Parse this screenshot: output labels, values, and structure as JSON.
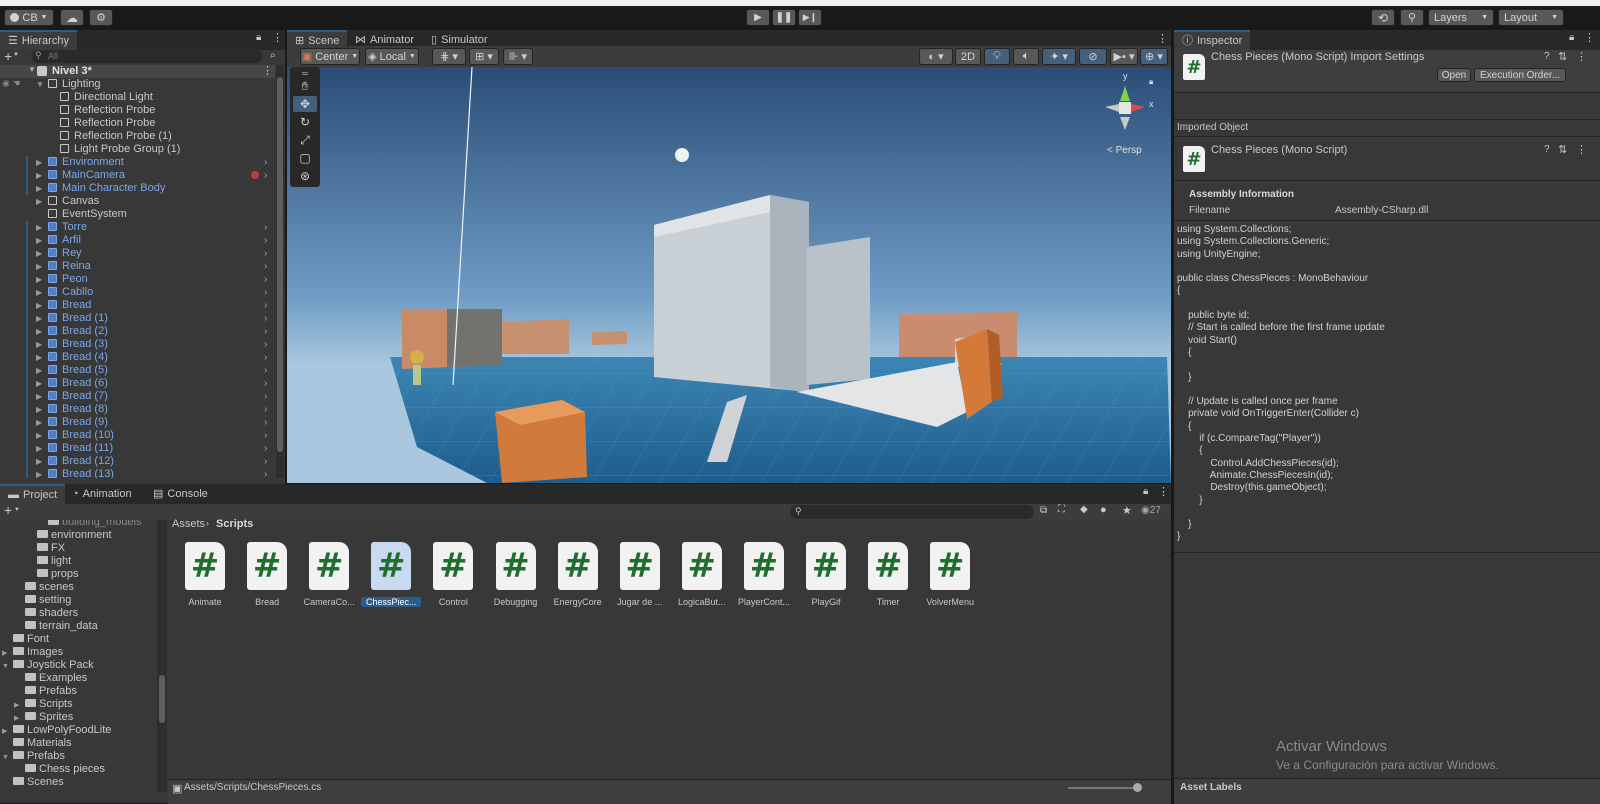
{
  "toolbar": {
    "account": "CB",
    "layers": "Layers",
    "layout": "Layout"
  },
  "hierarchy": {
    "tab": "Hierarchy",
    "search_placeholder": "All",
    "scene": "Nivel 3*",
    "items": [
      {
        "label": "Lighting",
        "indent": 1,
        "blue": false,
        "expand": "open",
        "arrow": false
      },
      {
        "label": "Directional Light",
        "indent": 2,
        "blue": false,
        "expand": "",
        "arrow": false
      },
      {
        "label": "Reflection Probe",
        "indent": 2,
        "blue": false,
        "expand": "",
        "arrow": false
      },
      {
        "label": "Reflection Probe",
        "indent": 2,
        "blue": false,
        "expand": "",
        "arrow": false
      },
      {
        "label": "Reflection Probe (1)",
        "indent": 2,
        "blue": false,
        "expand": "",
        "arrow": false
      },
      {
        "label": "Light Probe Group (1)",
        "indent": 2,
        "blue": false,
        "expand": "",
        "arrow": false
      },
      {
        "label": "Environment",
        "indent": 1,
        "blue": true,
        "expand": "closed",
        "arrow": true
      },
      {
        "label": "MainCamera",
        "indent": 1,
        "blue": true,
        "expand": "closed",
        "arrow": true
      },
      {
        "label": "Main Character Body",
        "indent": 1,
        "blue": true,
        "expand": "closed",
        "arrow": false
      },
      {
        "label": "Canvas",
        "indent": 1,
        "blue": false,
        "expand": "closed",
        "arrow": false
      },
      {
        "label": "EventSystem",
        "indent": 1,
        "blue": false,
        "expand": "",
        "arrow": false
      },
      {
        "label": "Torre",
        "indent": 1,
        "blue": true,
        "expand": "closed",
        "arrow": true
      },
      {
        "label": "Arfil",
        "indent": 1,
        "blue": true,
        "expand": "closed",
        "arrow": true
      },
      {
        "label": "Rey",
        "indent": 1,
        "blue": true,
        "expand": "closed",
        "arrow": true
      },
      {
        "label": "Reina",
        "indent": 1,
        "blue": true,
        "expand": "closed",
        "arrow": true
      },
      {
        "label": "Peon",
        "indent": 1,
        "blue": true,
        "expand": "closed",
        "arrow": true
      },
      {
        "label": "Cabllo",
        "indent": 1,
        "blue": true,
        "expand": "closed",
        "arrow": true
      },
      {
        "label": "Bread",
        "indent": 1,
        "blue": true,
        "expand": "closed",
        "arrow": true
      },
      {
        "label": "Bread (1)",
        "indent": 1,
        "blue": true,
        "expand": "closed",
        "arrow": true
      },
      {
        "label": "Bread (2)",
        "indent": 1,
        "blue": true,
        "expand": "closed",
        "arrow": true
      },
      {
        "label": "Bread (3)",
        "indent": 1,
        "blue": true,
        "expand": "closed",
        "arrow": true
      },
      {
        "label": "Bread (4)",
        "indent": 1,
        "blue": true,
        "expand": "closed",
        "arrow": true
      },
      {
        "label": "Bread (5)",
        "indent": 1,
        "blue": true,
        "expand": "closed",
        "arrow": true
      },
      {
        "label": "Bread (6)",
        "indent": 1,
        "blue": true,
        "expand": "closed",
        "arrow": true
      },
      {
        "label": "Bread (7)",
        "indent": 1,
        "blue": true,
        "expand": "closed",
        "arrow": true
      },
      {
        "label": "Bread (8)",
        "indent": 1,
        "blue": true,
        "expand": "closed",
        "arrow": true
      },
      {
        "label": "Bread (9)",
        "indent": 1,
        "blue": true,
        "expand": "closed",
        "arrow": true
      },
      {
        "label": "Bread (10)",
        "indent": 1,
        "blue": true,
        "expand": "closed",
        "arrow": true
      },
      {
        "label": "Bread (11)",
        "indent": 1,
        "blue": true,
        "expand": "closed",
        "arrow": true
      },
      {
        "label": "Bread (12)",
        "indent": 1,
        "blue": true,
        "expand": "closed",
        "arrow": true
      },
      {
        "label": "Bread (13)",
        "indent": 1,
        "blue": true,
        "expand": "closed",
        "arrow": true
      }
    ]
  },
  "scene": {
    "tabs": [
      "Scene",
      "Animator",
      "Simulator"
    ],
    "pivot": "Center",
    "space": "Local",
    "mode2d": "2D",
    "persp": "< Persp",
    "gizmo_y": "y",
    "gizmo_x": "x"
  },
  "inspector": {
    "tab": "Inspector",
    "title": "Chess Pieces (Mono Script) Import Settings",
    "open_label": "Open",
    "execution_label": "Execution Order...",
    "imported_object": "Imported Object",
    "object_name": "Chess Pieces (Mono Script)",
    "assembly_header": "Assembly Information",
    "filename_label": "Filename",
    "filename_value": "Assembly-CSharp.dll",
    "code": "using System.Collections;\nusing System.Collections.Generic;\nusing UnityEngine;\n\npublic class ChessPieces : MonoBehaviour\n{\n\n    public byte id;\n    // Start is called before the first frame update\n    void Start()\n    {\n\n    }\n\n    // Update is called once per frame\n    private void OnTriggerEnter(Collider c)\n    {\n        if (c.CompareTag(\"Player\"))\n        {\n            Control.AddChessPieces(id);\n            Animate.ChessPiecesIn(id);\n            Destroy(this.gameObject);\n        }\n\n    }\n}",
    "asset_labels": "Asset Labels"
  },
  "project": {
    "tabs": [
      "Project",
      "Animation",
      "Console"
    ],
    "breadcrumb_root": "Assets",
    "breadcrumb_leaf": "Scripts",
    "hidden_count": "27",
    "tree": [
      {
        "label": "environment",
        "indent": 3,
        "arrow": ""
      },
      {
        "label": "FX",
        "indent": 3,
        "arrow": ""
      },
      {
        "label": "light",
        "indent": 3,
        "arrow": ""
      },
      {
        "label": "props",
        "indent": 3,
        "arrow": ""
      },
      {
        "label": "scenes",
        "indent": 2,
        "arrow": ""
      },
      {
        "label": "setting",
        "indent": 2,
        "arrow": ""
      },
      {
        "label": "shaders",
        "indent": 2,
        "arrow": ""
      },
      {
        "label": "terrain_data",
        "indent": 2,
        "arrow": ""
      },
      {
        "label": "Font",
        "indent": 1,
        "arrow": ""
      },
      {
        "label": "Images",
        "indent": 1,
        "arrow": "closed"
      },
      {
        "label": "Joystick Pack",
        "indent": 1,
        "arrow": "open"
      },
      {
        "label": "Examples",
        "indent": 2,
        "arrow": ""
      },
      {
        "label": "Prefabs",
        "indent": 2,
        "arrow": ""
      },
      {
        "label": "Scripts",
        "indent": 2,
        "arrow": "closed"
      },
      {
        "label": "Sprites",
        "indent": 2,
        "arrow": "closed"
      },
      {
        "label": "LowPolyFoodLite",
        "indent": 1,
        "arrow": "closed"
      },
      {
        "label": "Materials",
        "indent": 1,
        "arrow": ""
      },
      {
        "label": "Prefabs",
        "indent": 1,
        "arrow": "open"
      },
      {
        "label": "Chess pieces",
        "indent": 2,
        "arrow": ""
      },
      {
        "label": "Scenes",
        "indent": 1,
        "arrow": ""
      }
    ],
    "assets": [
      {
        "label": "Animate",
        "selected": false
      },
      {
        "label": "Bread",
        "selected": false
      },
      {
        "label": "CameraCo...",
        "selected": false
      },
      {
        "label": "ChessPiec...",
        "selected": true
      },
      {
        "label": "Control",
        "selected": false
      },
      {
        "label": "Debugging",
        "selected": false
      },
      {
        "label": "EnergyCore",
        "selected": false
      },
      {
        "label": "Jugar de ...",
        "selected": false
      },
      {
        "label": "LogicaBut...",
        "selected": false
      },
      {
        "label": "PlayerCont...",
        "selected": false
      },
      {
        "label": "PlayGif",
        "selected": false
      },
      {
        "label": "Timer",
        "selected": false
      },
      {
        "label": "VolverMenu",
        "selected": false
      }
    ],
    "status_path": "Assets/Scripts/ChessPieces.cs"
  },
  "watermark": {
    "line1": "Activar Windows",
    "line2": "Ve a Configuración para activar Windows."
  },
  "colors": {
    "selection": "#2c5d87",
    "prefab_blue": "#7ba7e8",
    "script_green": "#1f6e2e",
    "panel": "#383838"
  }
}
